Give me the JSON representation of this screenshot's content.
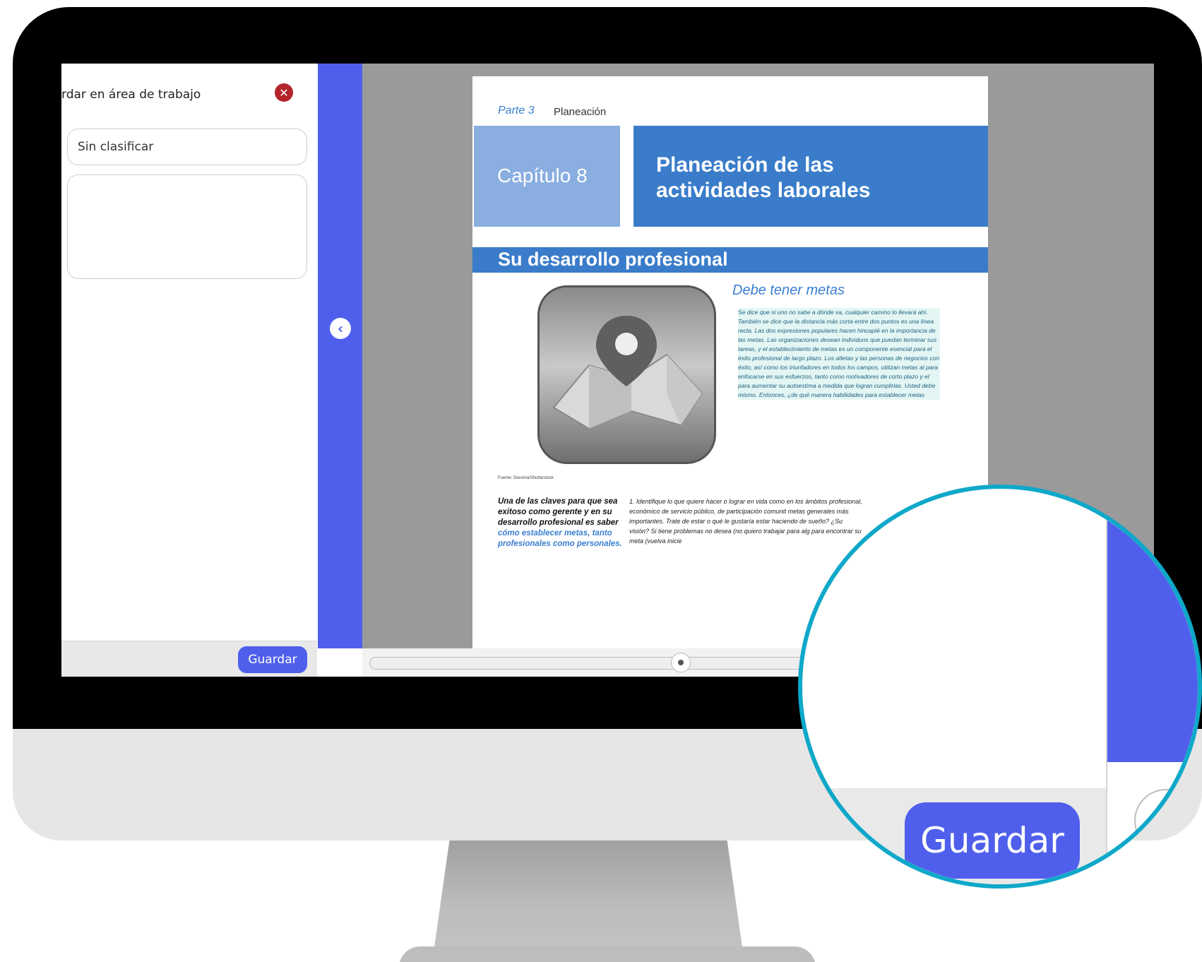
{
  "panel": {
    "title": "rdar en área de trabajo",
    "category_value": "Sin clasificar",
    "save_label": "Guardar"
  },
  "icons": {
    "close": "close-icon",
    "back": "chevron-left-icon",
    "map": "map-pin-icon"
  },
  "document": {
    "parte": "Parte 3",
    "parte_name": "Planeación",
    "chapter": "Capítulo 8",
    "chapter_title_line1": "Planeación de las",
    "chapter_title_line2": "actividades laborales",
    "section_title": "Su desarrollo profesional",
    "subheading": "Debe tener metas",
    "body": "Se dice que si uno no sabe a dónde va, cualquier camino lo llevará ahí. También se dice que la distancia más corta entre dos puntos es una línea recta. Las dos expresiones populares hacen hincapié en la importancia de las metas. Las organizaciones desean individuos que puedan terminar sus tareas, y el establecimiento de metas es un componente esencial para el éxito profesional de largo plazo. Los atletas y las personas de negocios con éxito, así como los triunfadores en todos los campos, utilizan metas al para enfocarse en sus esfuerzos, tanto como motivadores de corto plazo y el para aumentar su autoestima a medida que logran cumplirlas. Usted debe mismo. Entonces, ¿de qué manera habilidades para establecer metas",
    "credit": "Fuente: Devonia/Shutterstock",
    "lead_black": "Una de las claves para que sea exitoso como gerente y en su desarrollo profesional es saber",
    "lead_blue": "cómo establecer metas, tanto profesionales como personales.",
    "item": "1. Identifique lo que quiere hacer o lograr en vida como en los ámbitos profesional, económico de servicio público, de participación comunit metas generales más importantes. Trate de estar o qué le gustaría estar haciendo de sueño? ¿Su visión? Si tiene problemas no desea (no quiero trabajar para alg para encontrar su meta (vuelva inicie"
  },
  "zoom": {
    "save_label": "Guardar"
  },
  "colors": {
    "accent": "#4f5fec",
    "lens_ring": "#0fa8c9",
    "doc_blue": "#3a7cca",
    "doc_light_blue": "#8aaee0",
    "close_red": "#b3242b"
  }
}
